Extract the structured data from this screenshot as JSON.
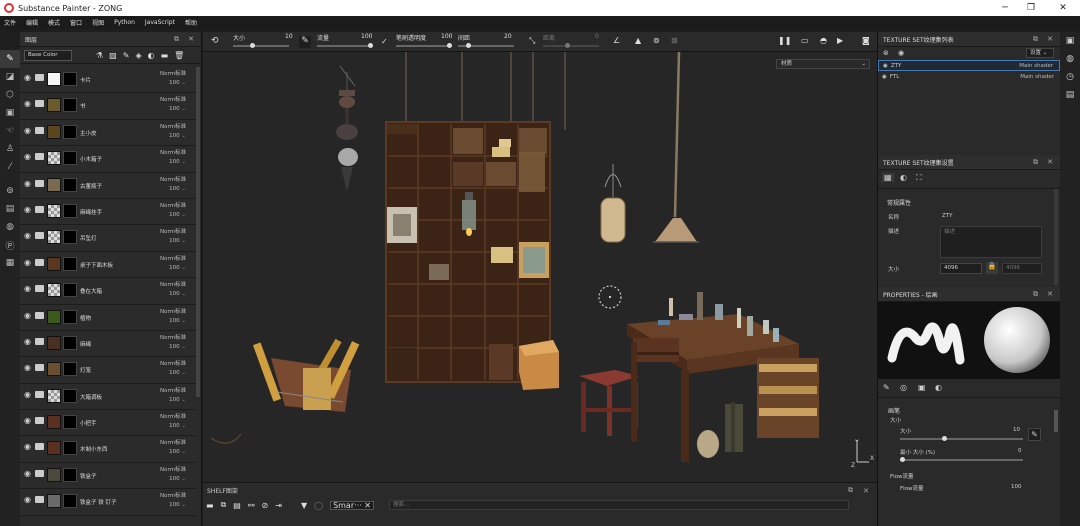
{
  "window": {
    "title": "Substance Painter - ZONG",
    "min": "─",
    "max": "❐",
    "close": "✕"
  },
  "menu": [
    "文件",
    "编辑",
    "模式",
    "窗口",
    "视图",
    "Python",
    "JavaScript",
    "帮助"
  ],
  "layers_panel": {
    "title": "图层",
    "channel": "Base Color",
    "layers": [
      {
        "name": "卡片",
        "blend": "Norm标准",
        "opacity": "100",
        "thumb": "#f5f5f5"
      },
      {
        "name": "书",
        "blend": "Norm标准",
        "opacity": "100",
        "thumb": "#6b5a2a"
      },
      {
        "name": "主小皮",
        "blend": "Norm标准",
        "opacity": "100",
        "thumb": "#5a4520"
      },
      {
        "name": "小木箱子",
        "blend": "Norm标准",
        "opacity": "100",
        "thumb": "checker"
      },
      {
        "name": "古董瓶子",
        "blend": "Norm标准",
        "opacity": "100",
        "thumb": "#7a6a50"
      },
      {
        "name": "麻绳挂手",
        "blend": "Norm标准",
        "opacity": "100",
        "thumb": "checker"
      },
      {
        "name": "吊坠灯",
        "blend": "Norm标准",
        "opacity": "100",
        "thumb": "checker"
      },
      {
        "name": "桌子下面木板",
        "blend": "Norm标准",
        "opacity": "100",
        "thumb": "#5a3820"
      },
      {
        "name": "叠在大箱",
        "blend": "Norm标准",
        "opacity": "100",
        "thumb": "checker"
      },
      {
        "name": "植物",
        "blend": "Norm标准",
        "opacity": "100",
        "thumb": "#3d5a1e"
      },
      {
        "name": "麻绳",
        "blend": "Norm标准",
        "opacity": "100",
        "thumb": "#4a3020"
      },
      {
        "name": "灯笼",
        "blend": "Norm标准",
        "opacity": "100",
        "thumb": "#6a5030"
      },
      {
        "name": "大箱调板",
        "blend": "Norm标准",
        "opacity": "100",
        "thumb": "checker"
      },
      {
        "name": "小把手",
        "blend": "Norm标准",
        "opacity": "100",
        "thumb": "#5a3020"
      },
      {
        "name": "木制小东西",
        "blend": "Norm标准",
        "opacity": "100",
        "thumb": "#5a3020"
      },
      {
        "name": "铁盒子",
        "blend": "Norm标准",
        "opacity": "100",
        "thumb": "#4a4a3a"
      },
      {
        "name": "铁盒子 铁 钉子",
        "blend": "Norm标准",
        "opacity": "100",
        "thumb": "#6a6a6a"
      }
    ]
  },
  "toolbar": {
    "size_label": "大小",
    "size_value": "10",
    "flow_label": "流量",
    "flow_value": "100",
    "stroke_opacity_label": "笔刷透明度",
    "stroke_opacity_value": "100",
    "spacing_label": "间距",
    "spacing_value": "20",
    "angle_label": "距离",
    "angle_value": "0"
  },
  "viewport": {
    "dropdown": "材质"
  },
  "shelf": {
    "title": "SHELF图架",
    "chip": "Smar··· ✕",
    "search_placeholder": "搜索..."
  },
  "texture_set_list": {
    "title": "TEXTURE SET纹理集列表",
    "settings_btn": "设置 ⌄",
    "rows": [
      {
        "name": "ZTY",
        "shader": "Main shader"
      },
      {
        "name": "FTL",
        "shader": "Main shader"
      }
    ]
  },
  "texture_set_settings": {
    "title": "TEXTURE SET纹理集设置",
    "section": "常规属性",
    "name_label": "名称",
    "name_value": "ZTY",
    "desc_label": "描述",
    "desc_placeholder": "描述",
    "size_label": "大小",
    "size_value": "4096",
    "size_locked_value": "4096"
  },
  "properties": {
    "title": "PROPERTIES - 绘画",
    "brush_section": "画笔",
    "size_label": "大小",
    "size_sub_label": "大小",
    "size_value": "10",
    "min_size_label": "最小 大小 (%)",
    "min_size_value": "0",
    "flow_section": "Flow流量",
    "flow_sub_label": "Flow流量",
    "flow_value": "100",
    "brush_fraction": 0.36,
    "min_fraction": 0.0
  },
  "colors": {
    "accent": "#4a7ab0",
    "panel": "#2a2a2a",
    "viewport": "#262626"
  }
}
